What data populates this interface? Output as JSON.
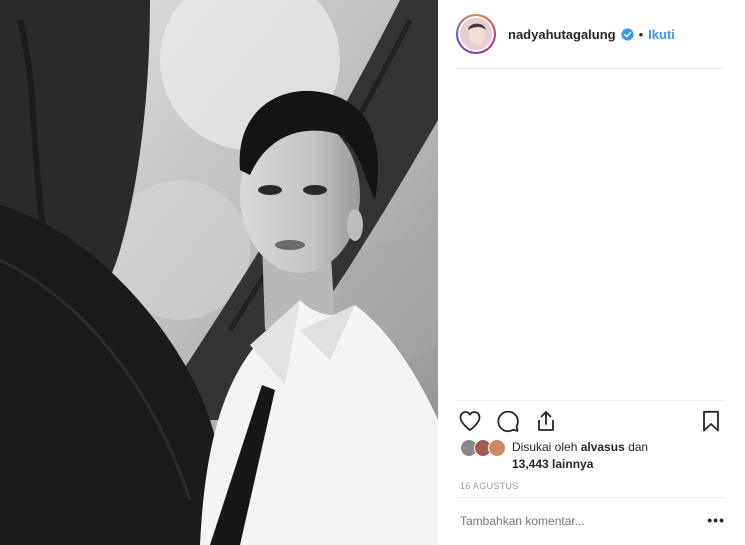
{
  "post": {
    "photo_alt": "nadyahutagalung",
    "header": {
      "username": "nadyahutagalung",
      "separator": "•",
      "follow_label": "Ikuti",
      "verified": true
    },
    "actions": {
      "like_icon": "heart-icon",
      "comment_icon": "comment-icon",
      "share_icon": "share-icon",
      "save_icon": "bookmark-icon"
    },
    "likes": {
      "prefix": "Disukai oleh ",
      "liked_by_user": "alvasus",
      "connector": " dan",
      "count": "13,443",
      "suffix": " lainnya"
    },
    "date": "16 AGUSTUS",
    "comment_placeholder": "Tambahkan komentar...",
    "more_label": "•••",
    "colors": {
      "link_blue": "#3897f0",
      "text": "#262626",
      "muted": "#999999",
      "divider": "#efefef"
    }
  }
}
